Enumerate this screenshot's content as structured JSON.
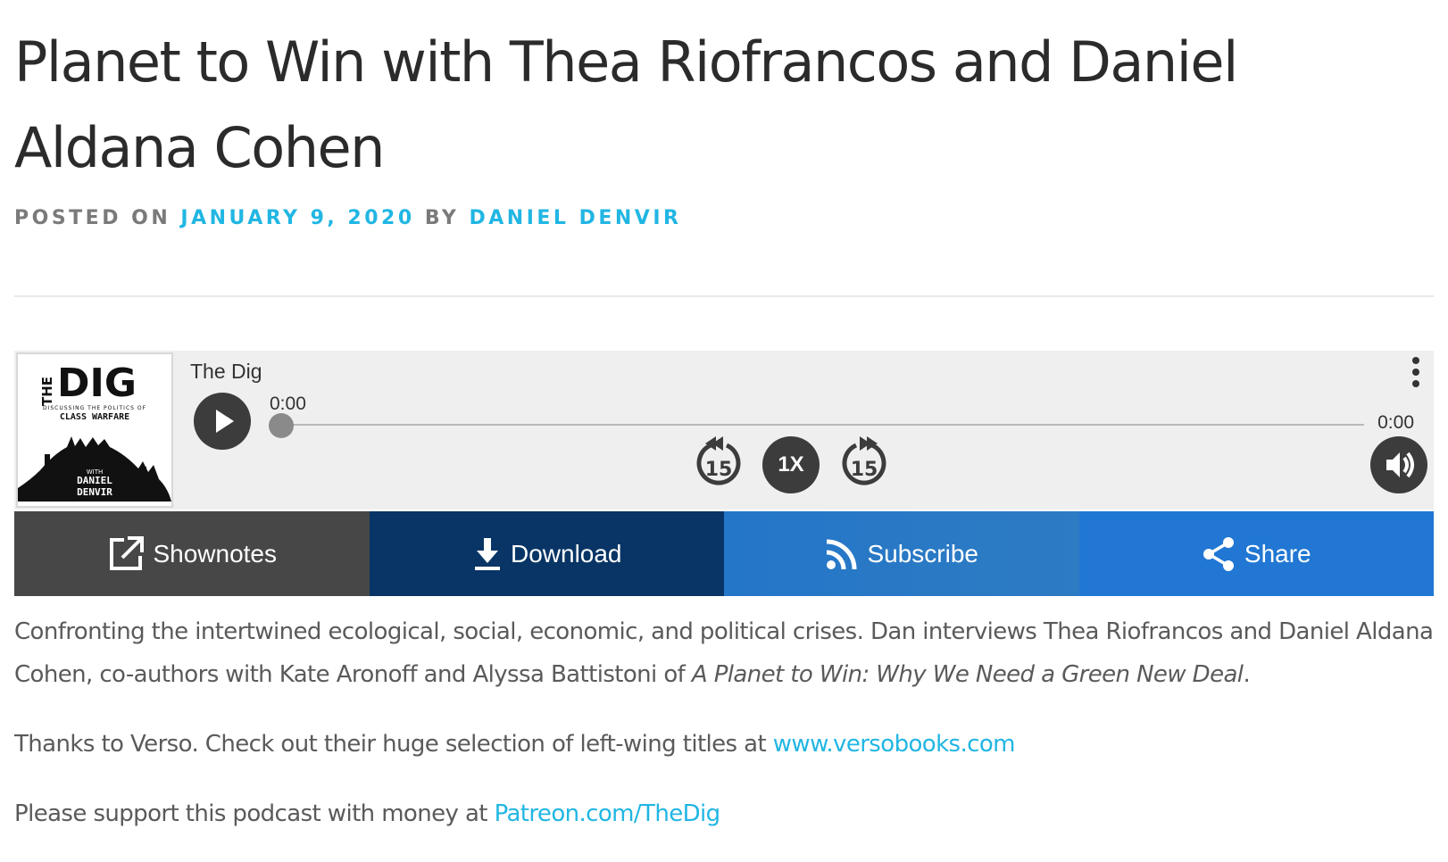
{
  "post": {
    "title": "Planet to Win with Thea Riofrancos and Daniel Aldana Cohen",
    "posted_on_label": "POSTED ON",
    "date": "JANUARY 9, 2020",
    "by_label": "BY",
    "author": "DANIEL DENVIR"
  },
  "player": {
    "show_name": "The Dig",
    "cover": {
      "line_the": "THE",
      "line_dig": "DIG",
      "line_sub1": "DISCUSSING THE POLITICS OF",
      "line_sub2": "CLASS WARFARE",
      "line_with": "WITH",
      "line_host1": "DANIEL",
      "line_host2": "DENVIR"
    },
    "current_time": "0:00",
    "duration": "0:00",
    "progress_fraction": 0,
    "skip_back_label": "15",
    "speed_label": "1X",
    "skip_forward_label": "15",
    "tabs": {
      "shownotes": "Shownotes",
      "download": "Download",
      "subscribe": "Subscribe",
      "share": "Share"
    }
  },
  "content": {
    "para1_text": "Confronting the intertwined ecological, social, economic, and political crises. Dan interviews Thea Riofrancos and Daniel Aldana Cohen, co-authors with Kate Aronoff and Alyssa Battistoni of ",
    "para1_book": "A Planet to Win: Why We Need a Green New Deal",
    "para1_end": ".",
    "para2_text": "Thanks to Verso. Check out their huge selection of left-wing titles at ",
    "para2_link": "www.versobooks.com",
    "para3_text": "Please support this podcast with money at ",
    "para3_link": "Patreon.com/TheDig"
  },
  "colors": {
    "link": "#21b6e3",
    "shownotes_bg": "#474747",
    "download_bg": "#083565",
    "subscribe_bg": "#2476c9",
    "share_bg": "#2177d3"
  },
  "icons": {
    "play": "play-icon",
    "skip_back": "rewind-15-icon",
    "skip_forward": "forward-15-icon",
    "volume": "volume-icon",
    "menu": "more-vertical-icon",
    "shownotes": "external-link-icon",
    "download": "download-icon",
    "subscribe": "rss-icon",
    "share": "share-icon"
  }
}
